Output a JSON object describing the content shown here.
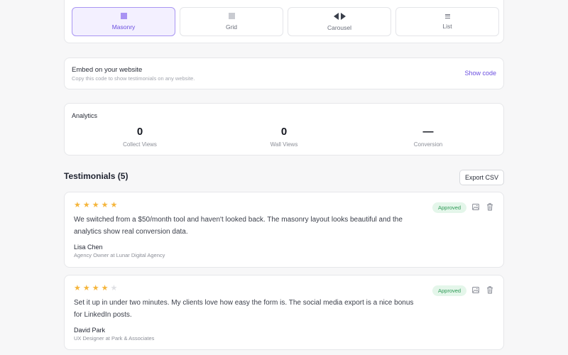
{
  "layout_options": [
    {
      "label": "Masonry",
      "icon": "masonry-icon",
      "active": true
    },
    {
      "label": "Grid",
      "icon": "grid-icon",
      "active": false
    },
    {
      "label": "Carousel",
      "icon": "carousel-icon",
      "active": false
    },
    {
      "label": "List",
      "icon": "list-icon",
      "active": false
    }
  ],
  "embed": {
    "title": "Embed on your website",
    "subtitle": "Copy this code to show testimonials on any website.",
    "action": "Show code"
  },
  "analytics": {
    "title": "Analytics",
    "stats": [
      {
        "value": "0",
        "label": "Collect Views"
      },
      {
        "value": "0",
        "label": "Wall Views"
      },
      {
        "value": "—",
        "label": "Conversion"
      }
    ]
  },
  "testimonials": {
    "heading": "Testimonials (5)",
    "export_label": "Export CSV",
    "items": [
      {
        "rating": 5,
        "text": "We switched from a $50/month tool and haven't looked back. The masonry layout looks beautiful and the analytics show real conversion data.",
        "author": "Lisa Chen",
        "role": "Agency Owner at Lunar Digital Agency",
        "status": "Approved"
      },
      {
        "rating": 4,
        "text": "Set it up in under two minutes. My clients love how easy the form is. The social media export is a nice bonus for LinkedIn posts.",
        "author": "David Park",
        "role": "UX Designer at Park & Associates",
        "status": "Approved"
      }
    ]
  },
  "colors": {
    "accent": "#6b4fe0",
    "star": "#f5b53b",
    "approved_bg": "#e4f6ea",
    "approved_text": "#2f9a57"
  }
}
